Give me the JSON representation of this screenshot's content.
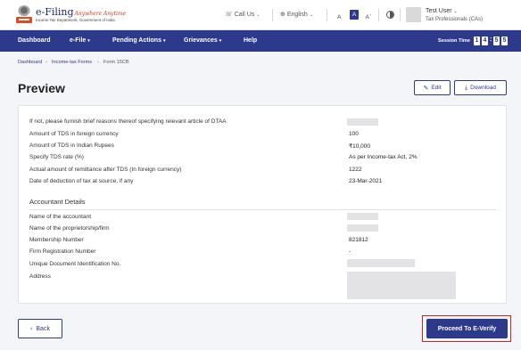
{
  "header": {
    "brand_title": "e-Filing",
    "brand_tagline": "Anywhere Anytime",
    "brand_subtitle": "Income Tax Department, Government of India",
    "call_us": "Call Us",
    "language": "English",
    "font_small": "A",
    "font_normal": "A",
    "font_large": "A",
    "user_name": "Test User",
    "user_role": "Tax Professionals (CAs)"
  },
  "nav": {
    "items": [
      "Dashboard",
      "e-File",
      "Pending Actions",
      "Grievances",
      "Help"
    ],
    "session_label": "Session Time",
    "session_digits": [
      "1",
      "4",
      "5",
      "5"
    ]
  },
  "breadcrumb": [
    "Dashboard",
    "Income-tax Forms",
    "Form 15CB"
  ],
  "page_title": "Preview",
  "actions": {
    "edit": "Edit",
    "download": "Download"
  },
  "details": [
    {
      "label": "If not, please furnish brief reasons thereof specifying relevant article of DTAA",
      "value": ""
    },
    {
      "label": "Amount of TDS in foreign currency",
      "value": "100"
    },
    {
      "label": "Amount of TDS in Indian Rupees",
      "value": "₹10,000"
    },
    {
      "label": "Specify TDS rate (%)",
      "value": "As per Income-tax Act, 2%"
    },
    {
      "label": "Actual amount of remittance after TDS (In foreign currency)",
      "value": "1222"
    },
    {
      "label": "Date of deduction of tax at source, if any",
      "value": "23-Mar-2021"
    }
  ],
  "accountant": {
    "section_title": "Accountant Details",
    "rows": [
      {
        "label": "Name of the accountant",
        "value": ""
      },
      {
        "label": "Name of the proprietorship/firm",
        "value": ""
      },
      {
        "label": "Membership Number",
        "value": "821812"
      },
      {
        "label": "Firm Registration Number",
        "value": "-"
      },
      {
        "label": "Unique Document Identification No.",
        "value": ""
      },
      {
        "label": "Address",
        "value": ""
      }
    ]
  },
  "footer": {
    "back": "Back",
    "proceed": "Proceed To E-Verify"
  },
  "colors": {
    "primary": "#2d3a8c",
    "highlight": "#c62828",
    "accent_orange": "#e24b1d"
  },
  "icons": [
    "emblem-logo-icon",
    "phone-icon",
    "globe-icon",
    "contrast-icon",
    "pencil-icon",
    "download-icon",
    "chevron-left-icon",
    "chevron-down-icon"
  ]
}
